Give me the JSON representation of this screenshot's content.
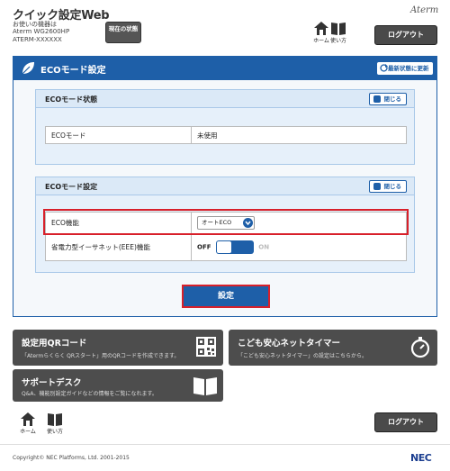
{
  "header": {
    "app_title": "クイック設定Web",
    "model_caption": "お使いの機器は",
    "model_name": "Aterm WG2600HP",
    "model_id": "ATERM-XXXXXX",
    "status_button": "現在の状態",
    "brand": "Aterm",
    "home_label": "ホーム",
    "help_label": "使い方",
    "logout_label": "ログアウト"
  },
  "panel": {
    "title": "ECOモード設定",
    "refresh_label": "最新状態に更新",
    "status_section": {
      "title": "ECOモード状態",
      "close_label": "閉じる",
      "rows": [
        {
          "label": "ECOモード",
          "value": "未使用"
        }
      ]
    },
    "settings_section": {
      "title": "ECOモード設定",
      "close_label": "閉じる",
      "eco_label": "ECO機能",
      "eco_value": "オートECO",
      "eee_label": "省電力型イーサネット(EEE)機能",
      "eee_off": "OFF",
      "eee_on": "ON"
    },
    "submit_label": "設定"
  },
  "tiles": {
    "qr": {
      "title": "設定用QRコード",
      "desc": "「Atermらくらく QRスタート」用のQRコードを作成できます。"
    },
    "timer": {
      "title": "こども安心ネットタイマー",
      "desc": "「こども安心ネットタイマー」の設定はこちらから。"
    },
    "support": {
      "title": "サポートデスク",
      "desc": "Q&A、機能別設定ガイドなどの情報をご覧になれます。"
    }
  },
  "footer": {
    "home_label": "ホーム",
    "help_label": "使い方",
    "logout_label": "ログアウト",
    "copyright": "Copyright© NEC Platforms, Ltd. 2001-2015",
    "logo": "NEC"
  },
  "colors": {
    "accent": "#1e5fa8",
    "highlight": "#d8202a",
    "tile_bg": "#4d4d4d"
  }
}
